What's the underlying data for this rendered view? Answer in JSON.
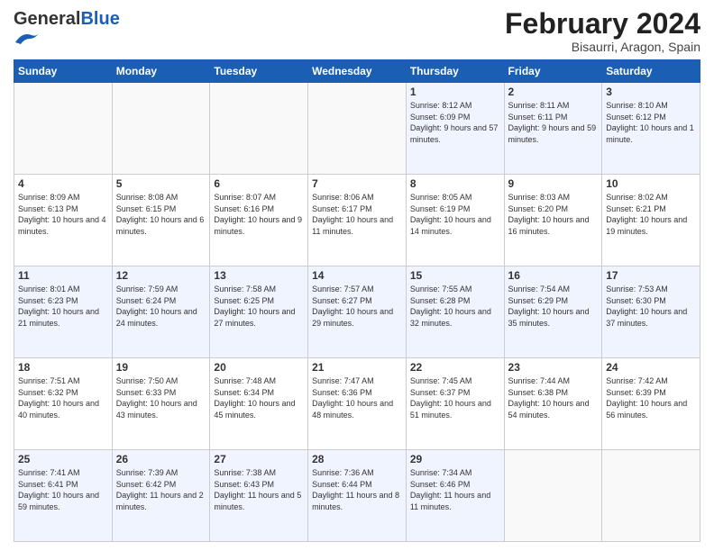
{
  "header": {
    "logo_general": "General",
    "logo_blue": "Blue",
    "month_title": "February 2024",
    "location": "Bisaurri, Aragon, Spain"
  },
  "weekdays": [
    "Sunday",
    "Monday",
    "Tuesday",
    "Wednesday",
    "Thursday",
    "Friday",
    "Saturday"
  ],
  "weeks": [
    [
      {
        "day": "",
        "empty": true
      },
      {
        "day": "",
        "empty": true
      },
      {
        "day": "",
        "empty": true
      },
      {
        "day": "",
        "empty": true
      },
      {
        "day": "1",
        "sunrise": "8:12 AM",
        "sunset": "6:09 PM",
        "daylight": "9 hours and 57 minutes."
      },
      {
        "day": "2",
        "sunrise": "8:11 AM",
        "sunset": "6:11 PM",
        "daylight": "9 hours and 59 minutes."
      },
      {
        "day": "3",
        "sunrise": "8:10 AM",
        "sunset": "6:12 PM",
        "daylight": "10 hours and 1 minute."
      }
    ],
    [
      {
        "day": "4",
        "sunrise": "8:09 AM",
        "sunset": "6:13 PM",
        "daylight": "10 hours and 4 minutes."
      },
      {
        "day": "5",
        "sunrise": "8:08 AM",
        "sunset": "6:15 PM",
        "daylight": "10 hours and 6 minutes."
      },
      {
        "day": "6",
        "sunrise": "8:07 AM",
        "sunset": "6:16 PM",
        "daylight": "10 hours and 9 minutes."
      },
      {
        "day": "7",
        "sunrise": "8:06 AM",
        "sunset": "6:17 PM",
        "daylight": "10 hours and 11 minutes."
      },
      {
        "day": "8",
        "sunrise": "8:05 AM",
        "sunset": "6:19 PM",
        "daylight": "10 hours and 14 minutes."
      },
      {
        "day": "9",
        "sunrise": "8:03 AM",
        "sunset": "6:20 PM",
        "daylight": "10 hours and 16 minutes."
      },
      {
        "day": "10",
        "sunrise": "8:02 AM",
        "sunset": "6:21 PM",
        "daylight": "10 hours and 19 minutes."
      }
    ],
    [
      {
        "day": "11",
        "sunrise": "8:01 AM",
        "sunset": "6:23 PM",
        "daylight": "10 hours and 21 minutes."
      },
      {
        "day": "12",
        "sunrise": "7:59 AM",
        "sunset": "6:24 PM",
        "daylight": "10 hours and 24 minutes."
      },
      {
        "day": "13",
        "sunrise": "7:58 AM",
        "sunset": "6:25 PM",
        "daylight": "10 hours and 27 minutes."
      },
      {
        "day": "14",
        "sunrise": "7:57 AM",
        "sunset": "6:27 PM",
        "daylight": "10 hours and 29 minutes."
      },
      {
        "day": "15",
        "sunrise": "7:55 AM",
        "sunset": "6:28 PM",
        "daylight": "10 hours and 32 minutes."
      },
      {
        "day": "16",
        "sunrise": "7:54 AM",
        "sunset": "6:29 PM",
        "daylight": "10 hours and 35 minutes."
      },
      {
        "day": "17",
        "sunrise": "7:53 AM",
        "sunset": "6:30 PM",
        "daylight": "10 hours and 37 minutes."
      }
    ],
    [
      {
        "day": "18",
        "sunrise": "7:51 AM",
        "sunset": "6:32 PM",
        "daylight": "10 hours and 40 minutes."
      },
      {
        "day": "19",
        "sunrise": "7:50 AM",
        "sunset": "6:33 PM",
        "daylight": "10 hours and 43 minutes."
      },
      {
        "day": "20",
        "sunrise": "7:48 AM",
        "sunset": "6:34 PM",
        "daylight": "10 hours and 45 minutes."
      },
      {
        "day": "21",
        "sunrise": "7:47 AM",
        "sunset": "6:36 PM",
        "daylight": "10 hours and 48 minutes."
      },
      {
        "day": "22",
        "sunrise": "7:45 AM",
        "sunset": "6:37 PM",
        "daylight": "10 hours and 51 minutes."
      },
      {
        "day": "23",
        "sunrise": "7:44 AM",
        "sunset": "6:38 PM",
        "daylight": "10 hours and 54 minutes."
      },
      {
        "day": "24",
        "sunrise": "7:42 AM",
        "sunset": "6:39 PM",
        "daylight": "10 hours and 56 minutes."
      }
    ],
    [
      {
        "day": "25",
        "sunrise": "7:41 AM",
        "sunset": "6:41 PM",
        "daylight": "10 hours and 59 minutes."
      },
      {
        "day": "26",
        "sunrise": "7:39 AM",
        "sunset": "6:42 PM",
        "daylight": "11 hours and 2 minutes."
      },
      {
        "day": "27",
        "sunrise": "7:38 AM",
        "sunset": "6:43 PM",
        "daylight": "11 hours and 5 minutes."
      },
      {
        "day": "28",
        "sunrise": "7:36 AM",
        "sunset": "6:44 PM",
        "daylight": "11 hours and 8 minutes."
      },
      {
        "day": "29",
        "sunrise": "7:34 AM",
        "sunset": "6:46 PM",
        "daylight": "11 hours and 11 minutes."
      },
      {
        "day": "",
        "empty": true
      },
      {
        "day": "",
        "empty": true
      }
    ]
  ],
  "labels": {
    "sunrise": "Sunrise:",
    "sunset": "Sunset:",
    "daylight": "Daylight:"
  }
}
